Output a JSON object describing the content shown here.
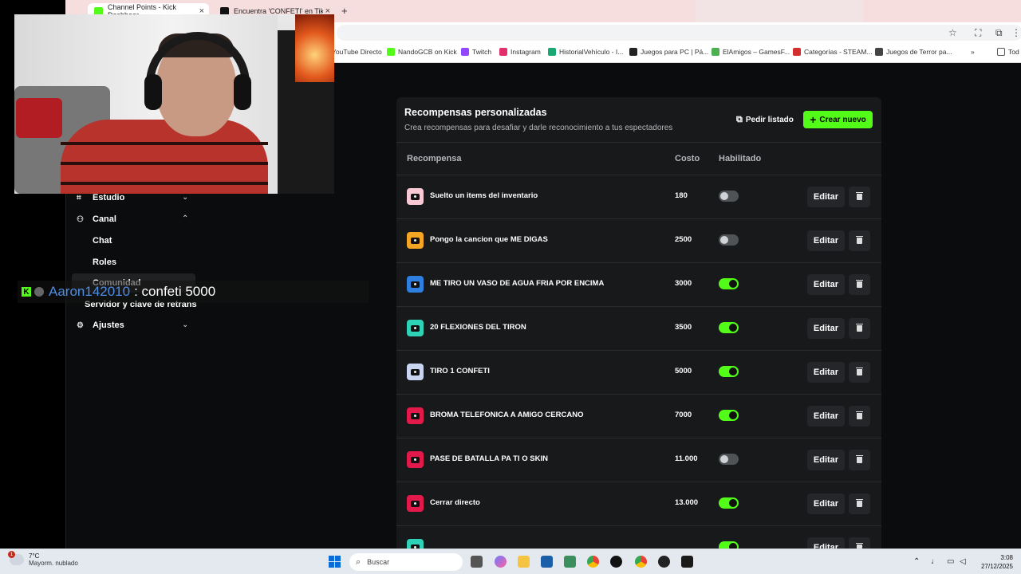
{
  "browser": {
    "tabs": [
      {
        "title": "Channel Points - Kick Dashboar",
        "active": true,
        "favicon_color": "#53fc18"
      },
      {
        "title": "Encuentra 'CONFETI' en TikTok",
        "active": false,
        "favicon_color": "#111111"
      }
    ],
    "bookmarks": [
      {
        "label": "YouTube Directo",
        "color": "#ff0000"
      },
      {
        "label": "NandoGCB on Kick",
        "color": "#53fc18"
      },
      {
        "label": "Twitch",
        "color": "#9146ff"
      },
      {
        "label": "Instagram",
        "color": "#e1306c"
      },
      {
        "label": "HistorialVehículo - I...",
        "color": "#18a874"
      },
      {
        "label": "Juegos para PC | Pá...",
        "color": "#222222"
      },
      {
        "label": "ElAmigos – GamesF...",
        "color": "#4caf50"
      },
      {
        "label": "Categorías - STEAM...",
        "color": "#d32f2f"
      },
      {
        "label": "Juegos de Terror pa...",
        "color": "#444444"
      },
      {
        "label": "Tod",
        "color": "#666666"
      }
    ]
  },
  "sidebar": {
    "items": [
      {
        "label": "Estudio",
        "icon": "studio-icon",
        "chevron": "chevron-down-icon"
      },
      {
        "label": "Canal",
        "icon": "channel-icon",
        "chevron": "chevron-up-icon"
      },
      {
        "label": "Ajustes",
        "icon": "gear-icon",
        "chevron": "chevron-down-icon"
      }
    ],
    "subitems": [
      "Chat",
      "Roles",
      "Comunidad",
      "Servidor y clave de retrans"
    ]
  },
  "chat_overlay": {
    "username": "Aaron142010",
    "message": ": confeti 5000"
  },
  "panel": {
    "title": "Recompensas personalizadas",
    "subtitle": "Crea recompensas para desafiar y darle reconocimiento a tus espectadores",
    "request_list_label": "Pedir listado",
    "create_new_label": "Crear nuevo",
    "columns": {
      "reward": "Recompensa",
      "cost": "Costo",
      "enabled": "Habilitado"
    },
    "edit_label": "Editar",
    "rows": [
      {
        "name": "Suelto un items del inventario",
        "cost": "180",
        "enabled": false,
        "color": "#f8c8d4"
      },
      {
        "name": "Pongo la cancion que ME DIGAS",
        "cost": "2500",
        "enabled": false,
        "color": "#f5a524"
      },
      {
        "name": "ME TIRO UN VASO DE AGUA FRIA POR ENCIMA",
        "cost": "3000",
        "enabled": true,
        "color": "#2f7fe0"
      },
      {
        "name": "20 FLEXIONES DEL TIRON",
        "cost": "3500",
        "enabled": true,
        "color": "#2ed3b7"
      },
      {
        "name": "TIRO 1 CONFETI",
        "cost": "5000",
        "enabled": true,
        "color": "#c8d4f0"
      },
      {
        "name": "BROMA TELEFONICA A AMIGO CERCANO",
        "cost": "7000",
        "enabled": true,
        "color": "#e3194b"
      },
      {
        "name": "PASE DE BATALLA PA TI O SKIN",
        "cost": "11.000",
        "enabled": false,
        "color": "#e3194b"
      },
      {
        "name": "Cerrar directo",
        "cost": "13.000",
        "enabled": true,
        "color": "#e3194b"
      },
      {
        "name": "",
        "cost": "",
        "enabled": true,
        "color": "#2ed3b7"
      }
    ]
  },
  "taskbar": {
    "weather_temp": "7°C",
    "weather_desc": "Mayorm. nublado",
    "weather_badge": "1",
    "search_placeholder": "Buscar",
    "time": "3:08",
    "date": "27/12/2025"
  }
}
